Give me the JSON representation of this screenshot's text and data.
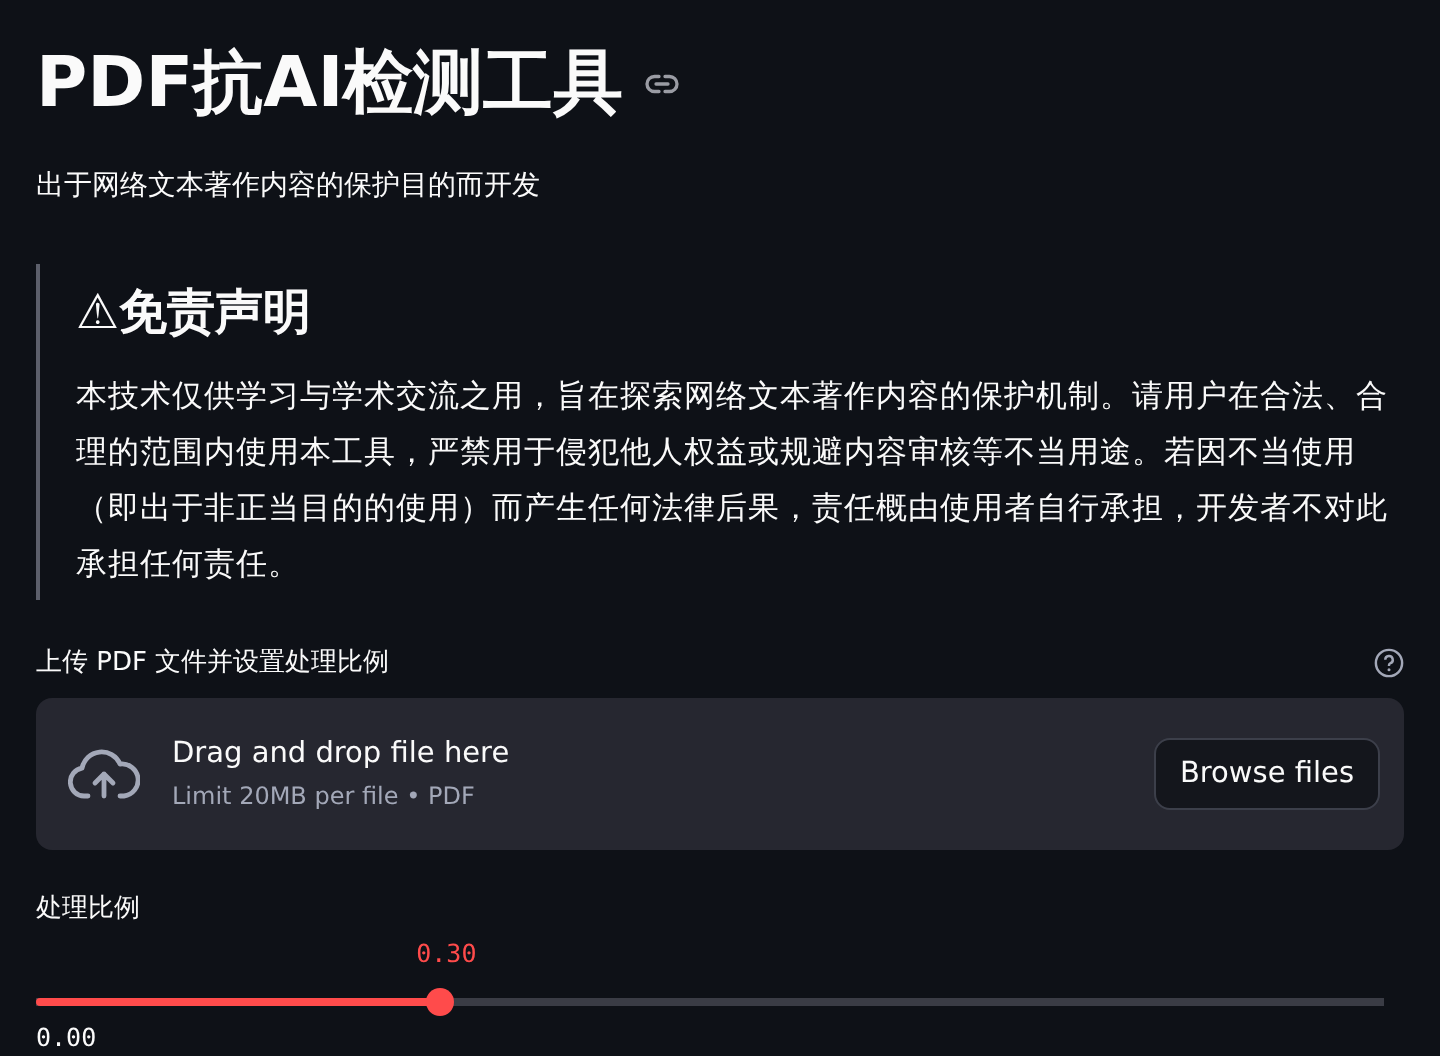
{
  "title": "PDF抗AI检测工具",
  "subtitle": "出于网络文本著作内容的保护目的而开发",
  "disclaimer": {
    "heading": "⚠免责声明",
    "body": "本技术仅供学习与学术交流之用，旨在探索网络文本著作内容的保护机制。请用户在合法、合理的范围内使用本工具，严禁用于侵犯他人权益或规避内容审核等不当用途。若因不当使用（即出于非正当目的的使用）而产生任何法律后果，责任概由使用者自行承担，开发者不对此承担任何责任。"
  },
  "uploader": {
    "label": "上传 PDF 文件并设置处理比例",
    "instruction": "Drag and drop file here",
    "limit": "Limit 20MB per file • PDF",
    "button": "Browse files"
  },
  "slider": {
    "label": "处理比例",
    "value": "0.30",
    "level": 0.3,
    "min": "0.00"
  }
}
